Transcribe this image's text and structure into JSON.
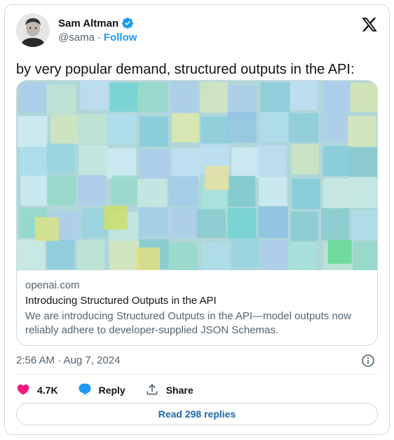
{
  "author": {
    "display_name": "Sam Altman",
    "handle": "@sama",
    "separator": "·",
    "follow_label": "Follow",
    "verified_color": "#1d9bf0"
  },
  "tweet": {
    "text": "by very popular demand, structured outputs in the API:"
  },
  "link_card": {
    "domain": "openai.com",
    "title": "Introducing Structured Outputs in the API",
    "description": "We are introducing Structured Outputs in the API—model outputs now reliably adhere to developer-supplied JSON Schemas."
  },
  "meta": {
    "timestamp": "2:56 AM · Aug 7, 2024"
  },
  "actions": {
    "like_count": "4.7K",
    "reply_label": "Reply",
    "share_label": "Share"
  },
  "read_replies_label": "Read 298 replies",
  "colors": {
    "like": "#f91880",
    "reply": "#1d9bf0",
    "link": "#1d9bf0",
    "muted": "#536471"
  },
  "icons": [
    "verified-badge-icon",
    "x-logo-icon",
    "info-icon",
    "heart-icon",
    "speech-bubble-icon",
    "share-icon"
  ]
}
